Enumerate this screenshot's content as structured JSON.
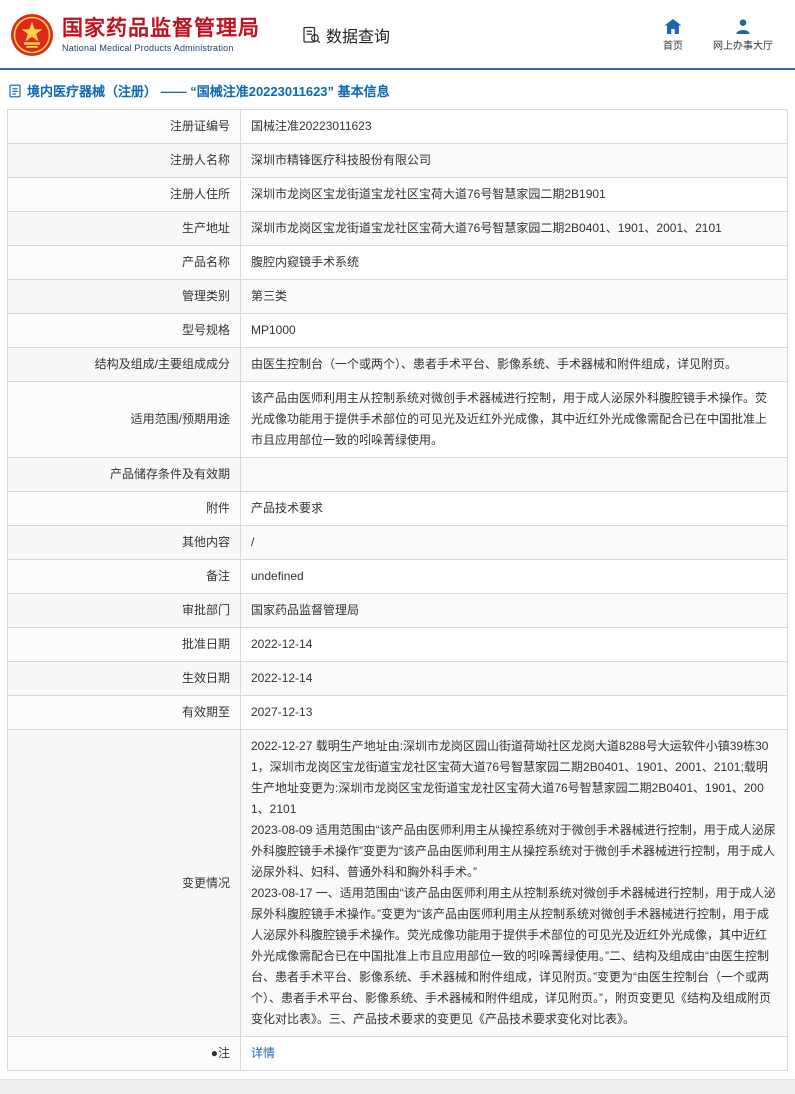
{
  "colors": {
    "brand_red": "#c1111c",
    "accent_blue": "#1e66b0",
    "title_blue": "#0a68b4",
    "divider_blue": "#2a66a8"
  },
  "header": {
    "agency_cn": "国家药品监督管理局",
    "agency_en": "National Medical Products Administration",
    "section": "数据查询",
    "nav": [
      {
        "label": "首页",
        "icon": "home-icon"
      },
      {
        "label": "网上办事大厅",
        "icon": "user-icon"
      }
    ]
  },
  "page_title": {
    "text": "境内医疗器械（注册） —— “国械注准20223011623” 基本信息"
  },
  "table": {
    "rows": [
      {
        "label": "注册证编号",
        "value": "国械注准20223011623"
      },
      {
        "label": "注册人名称",
        "value": "深圳市精锋医疗科技股份有限公司"
      },
      {
        "label": "注册人住所",
        "value": "深圳市龙岗区宝龙街道宝龙社区宝荷大道76号智慧家园二期2B1901"
      },
      {
        "label": "生产地址",
        "value": "深圳市龙岗区宝龙街道宝龙社区宝荷大道76号智慧家园二期2B0401、1901、2001、2101"
      },
      {
        "label": "产品名称",
        "value": "腹腔内窥镜手术系统"
      },
      {
        "label": "管理类别",
        "value": "第三类"
      },
      {
        "label": "型号规格",
        "value": "MP1000"
      },
      {
        "label": "结构及组成/主要组成成分",
        "value": "由医生控制台（一个或两个）、患者手术平台、影像系统、手术器械和附件组成，详见附页。"
      },
      {
        "label": "适用范围/预期用途",
        "value": "该产品由医师利用主从控制系统对微创手术器械进行控制，用于成人泌尿外科腹腔镜手术操作。荧光成像功能用于提供手术部位的可见光及近红外光成像，其中近红外光成像需配合已在中国批准上市且应用部位一致的吲哚菁绿使用。"
      },
      {
        "label": "产品储存条件及有效期",
        "value": ""
      },
      {
        "label": "附件",
        "value": "产品技术要求"
      },
      {
        "label": "其他内容",
        "value": "/"
      },
      {
        "label": "备注",
        "value": "undefined"
      },
      {
        "label": "审批部门",
        "value": "国家药品监督管理局"
      },
      {
        "label": "批准日期",
        "value": "2022-12-14"
      },
      {
        "label": "生效日期",
        "value": "2022-12-14"
      },
      {
        "label": "有效期至",
        "value": "2027-12-13"
      },
      {
        "label": "变更情况",
        "value": "2022-12-27 载明生产地址由:深圳市龙岗区园山街道荷坳社区龙岗大道8288号大运软件小镇39栋301，深圳市龙岗区宝龙街道宝龙社区宝荷大道76号智慧家园二期2B0401、1901、2001、2101;载明生产地址变更为:深圳市龙岗区宝龙街道宝龙社区宝荷大道76号智慧家园二期2B0401、1901、2001、2101\n2023-08-09 适用范围由“该产品由医师利用主从操控系统对于微创手术器械进行控制，用于成人泌尿外科腹腔镜手术操作”变更为“该产品由医师利用主从操控系统对于微创手术器械进行控制，用于成人泌尿外科、妇科、普通外科和胸外科手术。”\n2023-08-17 一、适用范围由“该产品由医师利用主从控制系统对微创手术器械进行控制，用于成人泌尿外科腹腔镜手术操作。”变更为“该产品由医师利用主从控制系统对微创手术器械进行控制，用于成人泌尿外科腹腔镜手术操作。荧光成像功能用于提供手术部位的可见光及近红外光成像，其中近红外光成像需配合已在中国批准上市且应用部位一致的吲哚菁绿使用。”二、结构及组成由“由医生控制台、患者手术平台、影像系统、手术器械和附件组成，详见附页。”变更为“由医生控制台（一个或两个）、患者手术平台、影像系统、手术器械和附件组成，详见附页。”，附页变更见《结构及组成附页变化对比表》。三、产品技术要求的变更见《产品技术要求变化对比表》。"
      },
      {
        "label": "●注",
        "value": "详情",
        "link": true
      }
    ]
  }
}
